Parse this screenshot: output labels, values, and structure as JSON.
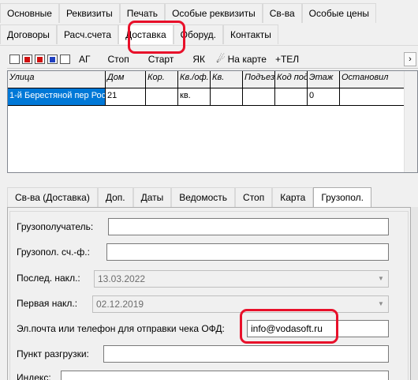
{
  "tabs_row1": [
    "Основные",
    "Реквизиты",
    "Печать",
    "Особые реквизиты",
    "Св-ва",
    "Особые цены"
  ],
  "tabs_row2": [
    "Договоры",
    "Расч.счета",
    "Доставка",
    "Оборуд.",
    "Контакты"
  ],
  "active_tab_row2": "Доставка",
  "toolbar": {
    "buttons": [
      "АГ",
      "Стоп",
      "Старт",
      "ЯК"
    ],
    "map_label": "На карте",
    "tel_label": "+ТЕЛ",
    "icons": [
      "list-icon",
      "delete-record-icon",
      "delete-all-icon",
      "add-record-icon",
      "find-icon"
    ]
  },
  "grid": {
    "columns": [
      "Улица",
      "Дом",
      "Кор.",
      "Кв./оф.",
      "Кв.",
      "Подъезд",
      "Код под",
      "Этаж",
      "Остановил"
    ],
    "row": [
      "1-й Берестяной пер Рос",
      "21",
      "",
      "кв.",
      "",
      "",
      "",
      "0",
      ""
    ]
  },
  "subtabs": [
    "Св-ва (Доставка)",
    "Доп.",
    "Даты",
    "Ведомость",
    "Стоп",
    "Карта",
    "Грузопол."
  ],
  "active_subtab": "Грузопол.",
  "form": {
    "consignee_label": "Грузополучатель:",
    "consignee_value": "",
    "invoice_label": "Грузопол. сч.-ф.:",
    "invoice_value": "",
    "last_invoice_label": "Послед. накл.:",
    "last_invoice_value": "13.03.2022",
    "first_invoice_label": "Первая накл.:",
    "first_invoice_value": "02.12.2019",
    "email_label": "Эл.почта или телефон для отправки чека ОФД:",
    "email_value": "info@vodasoft.ru",
    "unload_label": "Пункт разгрузки:",
    "unload_value": "",
    "index_label": "Индекс:"
  },
  "colors": {
    "highlight": "#e8102a",
    "selection": "#0078d7"
  }
}
